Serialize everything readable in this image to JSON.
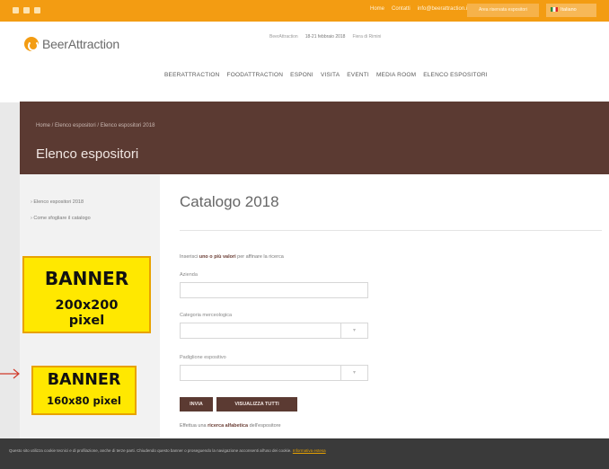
{
  "topbar": {
    "links": [
      "Home",
      "Contatti",
      "info@beerattraction.it"
    ],
    "cta": "Area riservata espositori",
    "language": "Italiano"
  },
  "logo": {
    "name": "BeerAttraction"
  },
  "header": {
    "dates": [
      "BeerAttraction",
      "18-21 febbraio 2018",
      "Fiera di Rimini"
    ]
  },
  "nav": [
    "BEERATTRACTION",
    "FOODATTRACTION",
    "ESPONI",
    "VISITA",
    "EVENTI",
    "MEDIA ROOM",
    "ELENCO ESPOSITORI"
  ],
  "hero": {
    "breadcrumb": "Home / Elenco espositori / Elenco espositori 2018",
    "title": "Elenco espositori"
  },
  "sidebar": {
    "items": [
      "› Elenco espositori 2018",
      "› Come sfogliare il catalogo"
    ]
  },
  "main": {
    "title": "Catalogo 2018",
    "intro_pre": "Inserisci ",
    "intro_bold": "uno o più valori",
    "intro_post": " per affinare la ricerca",
    "fields": [
      {
        "label": "Azienda"
      },
      {
        "label": "Categoria merceologica"
      },
      {
        "label": "Padiglione espositivo"
      }
    ],
    "buttons": [
      "INVIA",
      "VISUALIZZA TUTTI"
    ],
    "note_pre": "Effettua una ",
    "note_bold": "ricerca alfabetica",
    "note_post": " dell'espositore"
  },
  "banners": [
    {
      "line1": "BANNER",
      "line2": "200x200",
      "line3": "pixel"
    },
    {
      "line1": "BANNER",
      "line2": "160x80 pixel"
    }
  ],
  "cookie": {
    "text": "Questo sito utilizza cookie tecnici e di profilazione, anche di terze parti. Chiudendo questo banner o proseguendo la navigazione acconsenti all'uso dei cookie.",
    "link": "Informativa estesa"
  },
  "colors": {
    "accent": "#f39c12",
    "brand_brown": "#5b3a32",
    "banner_yellow": "#ffe800"
  }
}
